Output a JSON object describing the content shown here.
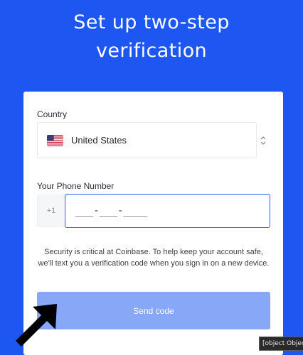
{
  "heading": {
    "line1": "Set up two-step",
    "line2": "verification"
  },
  "form": {
    "country_label": "Country",
    "country_value": "United States",
    "country_flag_icon": "us-flag-icon",
    "phone_label": "Your Phone Number",
    "phone_prefix": "+1",
    "phone_placeholder": "___-___-____",
    "phone_value": "",
    "security_note": "Security is critical at Coinbase. To help keep your account safe, we'll text you a verification code when you sign in on a new device.",
    "send_label": "Send code"
  },
  "tooltip": {
    "text": "[object Object]"
  },
  "colors": {
    "background": "#1d56f0",
    "input_focus_border": "#2e63f0",
    "button_disabled": "#86a8f7"
  }
}
